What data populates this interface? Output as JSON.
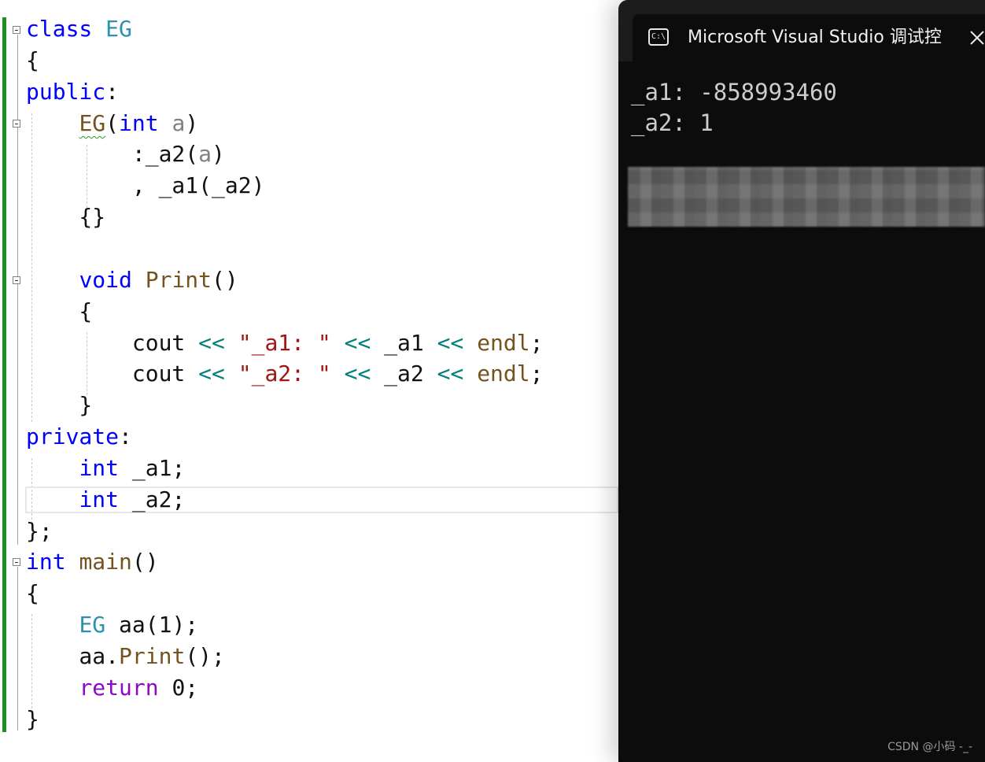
{
  "editor": {
    "lines": [
      {
        "tokens": [
          {
            "t": "class",
            "c": "kw"
          },
          {
            "t": " "
          },
          {
            "t": "EG",
            "c": "ty"
          }
        ]
      },
      {
        "tokens": [
          {
            "t": "{"
          }
        ]
      },
      {
        "tokens": [
          {
            "t": "public",
            "c": "kw"
          },
          {
            "t": ":"
          }
        ]
      },
      {
        "tokens": [
          {
            "t": "    "
          },
          {
            "t": "EG",
            "c": "fn squiggle"
          },
          {
            "t": "("
          },
          {
            "t": "int",
            "c": "kw"
          },
          {
            "t": " "
          },
          {
            "t": "a",
            "c": "prm"
          },
          {
            "t": ")"
          }
        ]
      },
      {
        "tokens": [
          {
            "t": "        :_a2("
          },
          {
            "t": "a",
            "c": "prm"
          },
          {
            "t": ")"
          }
        ]
      },
      {
        "tokens": [
          {
            "t": "        , _a1(_a2)"
          }
        ]
      },
      {
        "tokens": [
          {
            "t": "    {}"
          }
        ]
      },
      {
        "tokens": []
      },
      {
        "tokens": [
          {
            "t": "    "
          },
          {
            "t": "void",
            "c": "kw"
          },
          {
            "t": " "
          },
          {
            "t": "Print",
            "c": "fn"
          },
          {
            "t": "()"
          }
        ]
      },
      {
        "tokens": [
          {
            "t": "    {"
          }
        ]
      },
      {
        "tokens": [
          {
            "t": "        cout "
          },
          {
            "t": "<<",
            "c": "op"
          },
          {
            "t": " "
          },
          {
            "t": "\"_a1: \"",
            "c": "str"
          },
          {
            "t": " "
          },
          {
            "t": "<<",
            "c": "op"
          },
          {
            "t": " _a1 "
          },
          {
            "t": "<<",
            "c": "op"
          },
          {
            "t": " "
          },
          {
            "t": "endl",
            "c": "fn"
          },
          {
            "t": ";"
          }
        ]
      },
      {
        "tokens": [
          {
            "t": "        cout "
          },
          {
            "t": "<<",
            "c": "op"
          },
          {
            "t": " "
          },
          {
            "t": "\"_a2: \"",
            "c": "str"
          },
          {
            "t": " "
          },
          {
            "t": "<<",
            "c": "op"
          },
          {
            "t": " _a2 "
          },
          {
            "t": "<<",
            "c": "op"
          },
          {
            "t": " "
          },
          {
            "t": "endl",
            "c": "fn"
          },
          {
            "t": ";"
          }
        ]
      },
      {
        "tokens": [
          {
            "t": "    }"
          }
        ]
      },
      {
        "tokens": [
          {
            "t": "private",
            "c": "kw"
          },
          {
            "t": ":"
          }
        ]
      },
      {
        "tokens": [
          {
            "t": "    "
          },
          {
            "t": "int",
            "c": "kw"
          },
          {
            "t": " _a1;"
          }
        ]
      },
      {
        "tokens": [
          {
            "t": "    "
          },
          {
            "t": "int",
            "c": "kw"
          },
          {
            "t": " _a2;"
          }
        ]
      },
      {
        "tokens": [
          {
            "t": "};"
          }
        ]
      },
      {
        "tokens": [
          {
            "t": "int",
            "c": "kw"
          },
          {
            "t": " "
          },
          {
            "t": "main",
            "c": "fn"
          },
          {
            "t": "()"
          }
        ]
      },
      {
        "tokens": [
          {
            "t": "{"
          }
        ]
      },
      {
        "tokens": [
          {
            "t": "    "
          },
          {
            "t": "EG",
            "c": "ty"
          },
          {
            "t": " aa(1);"
          }
        ]
      },
      {
        "tokens": [
          {
            "t": "    aa."
          },
          {
            "t": "Print",
            "c": "fn"
          },
          {
            "t": "();"
          }
        ]
      },
      {
        "tokens": [
          {
            "t": "    "
          },
          {
            "t": "return",
            "c": "ctl"
          },
          {
            "t": " 0;"
          }
        ]
      },
      {
        "tokens": [
          {
            "t": "}"
          }
        ]
      }
    ]
  },
  "console": {
    "title": "Microsoft Visual Studio 调试控",
    "icon": "cmd-prompt-icon",
    "close_icon": "close-icon",
    "output": {
      "line1": "_a1: -858993460",
      "line2": "_a2: 1"
    }
  },
  "watermark": "CSDN @小码 -_-",
  "colors": {
    "keyword": "#0000ff",
    "control": "#8f08c4",
    "type": "#2b91af",
    "function": "#74531f",
    "string": "#a31515",
    "operator": "#008080",
    "parameter": "#808080",
    "change_bar": "#1f8f1f",
    "console_bg": "#0c0c0c",
    "console_text": "#cccccc"
  }
}
